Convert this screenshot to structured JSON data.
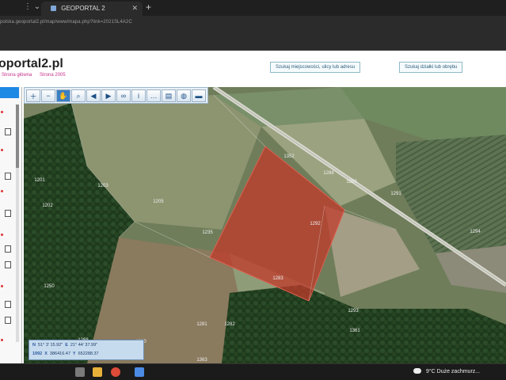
{
  "browser": {
    "tab_title": "GEOPORTAL 2",
    "tab_close": "✕",
    "new_tab": "+",
    "nav_icons": "⋮ ⌄",
    "url": "polska.geoportal2.pl/map/www/mapa.php?link=2021SL4A2C"
  },
  "page": {
    "logo": "oportal2.pl",
    "breadcrumbs": [
      "Strona główna",
      "Strona 2005"
    ],
    "button_search_address": "Szukaj miejscowości, ulicy lub adresu",
    "button_search_parcel": "Szukaj działki lub obrębu"
  },
  "toolbar": {
    "tools": [
      "zoom-in-icon",
      "zoom-out-icon",
      "pan-hand-icon",
      "zoom-box-icon",
      "back-arrow-icon",
      "forward-arrow-icon",
      "link-icon",
      "info-icon",
      "measure-icon",
      "print-icon",
      "globe-icon",
      "layers-icon"
    ]
  },
  "map": {
    "parcel_labels": [
      "1201",
      "1202",
      "1203",
      "1205",
      "1235",
      "1250",
      "1268",
      "1280",
      "1281",
      "1282",
      "1283",
      "1288",
      "1290",
      "1291",
      "1292",
      "1293",
      "1294",
      "1352",
      "1361",
      "1363"
    ],
    "selected_parcel_color": "#c0392b"
  },
  "coords": {
    "lat_label": "N",
    "lat_value": "51° 3' 15.92\"",
    "lon_label": "E",
    "lon_value": "21° 44' 37.99\"",
    "x_label": "X",
    "x_value": "386416.47",
    "y_label": "Y",
    "y_value": "652288.37",
    "system": "1992"
  },
  "taskbar": {
    "weather_text": "9°C  Duże zachmurz..."
  }
}
